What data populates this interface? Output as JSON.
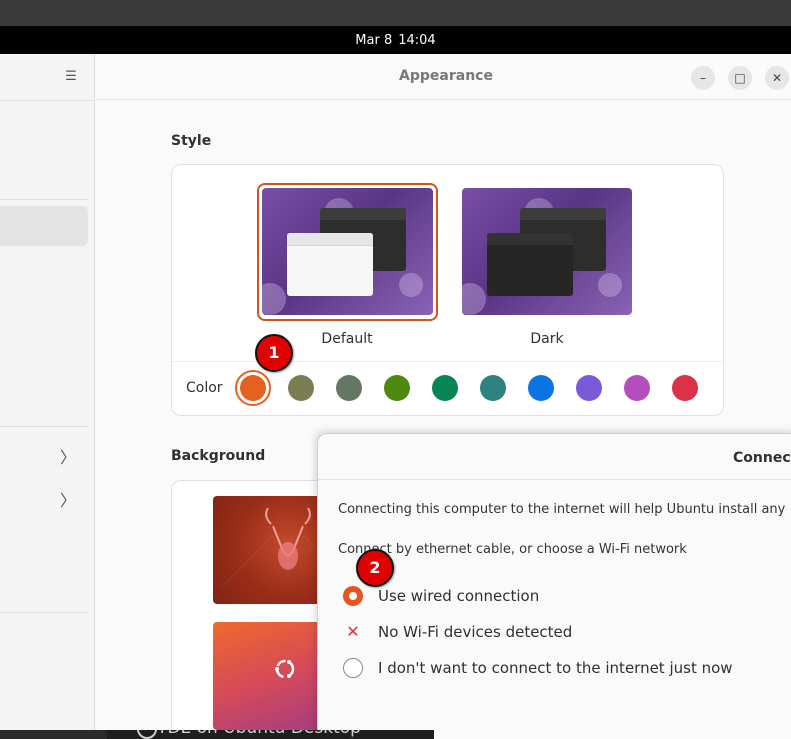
{
  "topbar": {
    "date": "Mar 8",
    "time": "14:04"
  },
  "window": {
    "title": "Appearance",
    "minimize_glyph": "–",
    "maximize_glyph": "□",
    "close_glyph": "✕"
  },
  "sidebar": {
    "menu_glyph": "☰",
    "chevron_glyph": "〉"
  },
  "style": {
    "heading": "Style",
    "options": [
      {
        "label": "Default",
        "selected": true
      },
      {
        "label": "Dark",
        "selected": false
      }
    ],
    "color_label": "Color",
    "colors": [
      "#e6611f",
      "#7b7e52",
      "#647764",
      "#4d8a0f",
      "#088554",
      "#2e8280",
      "#0b73e2",
      "#7a5ad8",
      "#b44ebd",
      "#dc3146"
    ],
    "selected_color": "#e6611f"
  },
  "background": {
    "heading": "Background"
  },
  "annotations": {
    "badge1": "1",
    "badge2": "2"
  },
  "dialog": {
    "title": "Connect",
    "description": "Connecting this computer to the internet will help Ubuntu install any",
    "prompt": "Connect by ethernet cable, or choose a Wi-Fi network",
    "options": [
      {
        "label": "Use wired connection",
        "state": "selected"
      },
      {
        "label": "No Wi-Fi devices detected",
        "state": "unavailable"
      },
      {
        "label": "I don't want to connect to the internet just now",
        "state": "unselected"
      }
    ]
  },
  "taskbar": {
    "label": "TDE on Ubuntu Desktop"
  }
}
